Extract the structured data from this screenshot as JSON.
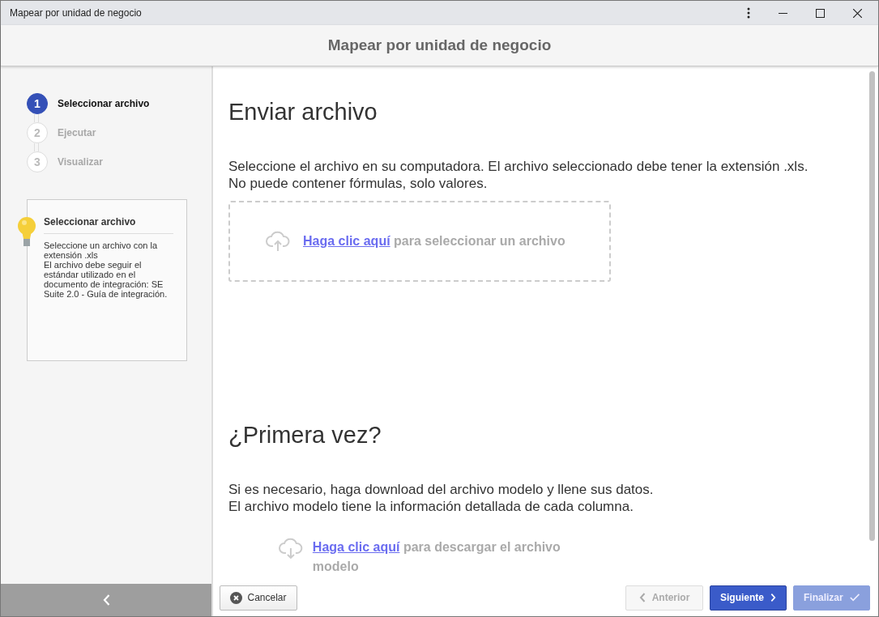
{
  "window": {
    "title": "Mapear por unidad de negocio"
  },
  "header": {
    "title": "Mapear por unidad de negocio"
  },
  "steps": [
    {
      "number": "1",
      "label": "Seleccionar archivo",
      "selected": true
    },
    {
      "number": "2",
      "label": "Ejecutar",
      "selected": false
    },
    {
      "number": "3",
      "label": "Visualizar",
      "selected": false
    }
  ],
  "tip": {
    "title": "Seleccionar archivo",
    "lines": [
      "Seleccione un archivo con la extensión .xls",
      "El archivo debe seguir el estándar utilizado en el documento de integración: SE Suite 2.0 - Guía de integración."
    ]
  },
  "upload": {
    "title": "Enviar archivo",
    "description": [
      "Seleccione el archivo en su computadora. El archivo seleccionado debe tener la extensión .xls.",
      "No puede contener fórmulas, solo valores."
    ],
    "link": "Haga clic aquí",
    "text": "para seleccionar un archivo"
  },
  "first_time": {
    "title": "¿Primera vez?",
    "description": [
      "Si es necesario, haga download del archivo modelo y llene sus datos.",
      "El archivo modelo tiene la información detallada de cada columna."
    ],
    "link": "Haga clic aquí",
    "text": "para descargar el archivo modelo"
  },
  "buttons": [
    {
      "label": "Cancelar",
      "kind": "cancel",
      "disabled": false
    },
    {
      "label": "Anterior",
      "kind": "back",
      "disabled": true
    },
    {
      "label": "Siguiente",
      "kind": "next",
      "disabled": false
    },
    {
      "label": "Finalizar",
      "kind": "finish",
      "disabled": true
    }
  ]
}
